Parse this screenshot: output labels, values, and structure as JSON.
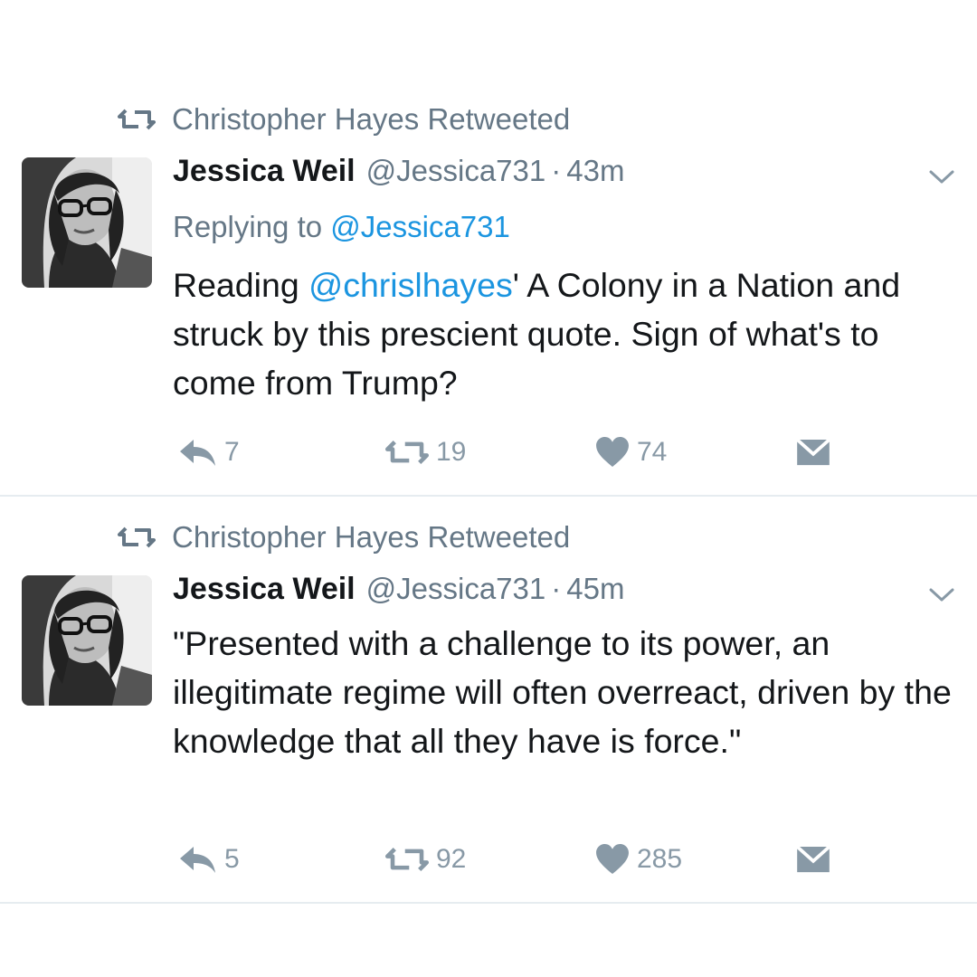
{
  "tweets": [
    {
      "retweeted_by": "Christopher Hayes Retweeted",
      "name": "Jessica Weil",
      "handle": "@Jessica731",
      "dot": "·",
      "time": "43m",
      "replying_label": "Replying to ",
      "replying_handle": "@Jessica731",
      "text_before": "Reading ",
      "mention": "@chrislhayes",
      "text_after": "' A Colony in a Nation and struck by this prescient quote. Sign of what's to come from Trump?",
      "replies": "7",
      "retweets": "19",
      "likes": "74"
    },
    {
      "retweeted_by": "Christopher Hayes Retweeted",
      "name": "Jessica Weil",
      "handle": "@Jessica731",
      "dot": "·",
      "time": "45m",
      "text": "\"Presented with a challenge to its power, an illegitimate regime will often overreact, driven by the knowledge that all they have is force.\"",
      "replies": "5",
      "retweets": "92",
      "likes": "285"
    }
  ],
  "colors": {
    "text": "#14171a",
    "secondary": "#657786",
    "link": "#1b95e0",
    "action": "#8899a6",
    "divider": "#e6ecf0"
  },
  "icons": {
    "retweet": "retweet-icon",
    "reply": "reply-icon",
    "like": "heart-icon",
    "message": "envelope-icon",
    "menu": "chevron-down-icon"
  }
}
